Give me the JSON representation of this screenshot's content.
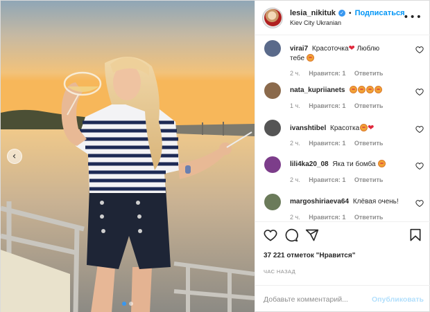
{
  "post": {
    "author": {
      "username": "lesia_nikituk",
      "verified": true,
      "follow_label": "Подписаться",
      "location": "Kiev City Ukranian"
    },
    "image": {
      "description_icon": "photo-woman-wine-glass-sunset",
      "slide_count": 2,
      "active_slide": 1
    },
    "comments": [
      {
        "username": "virai7",
        "text": "Красоточка",
        "emoji_after": "heart",
        "text2": " Люблю",
        "line2": "тебе",
        "line2_emoji": 1,
        "time": "2 ч.",
        "likes": "Нравится: 1",
        "reply": "Ответить",
        "avatar_color": "#5a6a8a"
      },
      {
        "username": "nata_kupriianets",
        "text": "",
        "emoji_count": 4,
        "time": "1 ч.",
        "likes": "Нравится: 1",
        "reply": "Ответить",
        "avatar_color": "#8b6a4c"
      },
      {
        "username": "ivanshtibel",
        "text": "Красотка",
        "emoji_count": 1,
        "extra": "heart",
        "time": "2 ч.",
        "likes": "Нравится: 1",
        "reply": "Ответить",
        "avatar_color": "#555555"
      },
      {
        "username": "lili4ka20_08",
        "text": "Яка ти бомба ",
        "emoji_count": 1,
        "time": "2 ч.",
        "likes": "Нравится: 1",
        "reply": "Ответить",
        "avatar_color": "#7c3d8a"
      },
      {
        "username": "margoshiriaeva64",
        "text": "Клёвая очень!",
        "emoji_count": 0,
        "time": "2 ч.",
        "likes": "Нравится: 1",
        "reply": "Ответить",
        "avatar_color": "#6b7b5a"
      }
    ],
    "actions": {
      "like_icon": "heart-icon",
      "comment_icon": "comment-icon",
      "share_icon": "share-icon",
      "save_icon": "bookmark-icon"
    },
    "likes_text": "37 221 отметок \"Нравится\"",
    "time_ago": "ЧАС НАЗАД",
    "add_comment": {
      "placeholder": "Добавьте комментарий...",
      "publish_label": "Опубликовать"
    },
    "colors": {
      "link_blue": "#0095f6",
      "muted": "#8e8e8e",
      "text": "#262626",
      "publish_disabled": "#b2dffc"
    }
  }
}
